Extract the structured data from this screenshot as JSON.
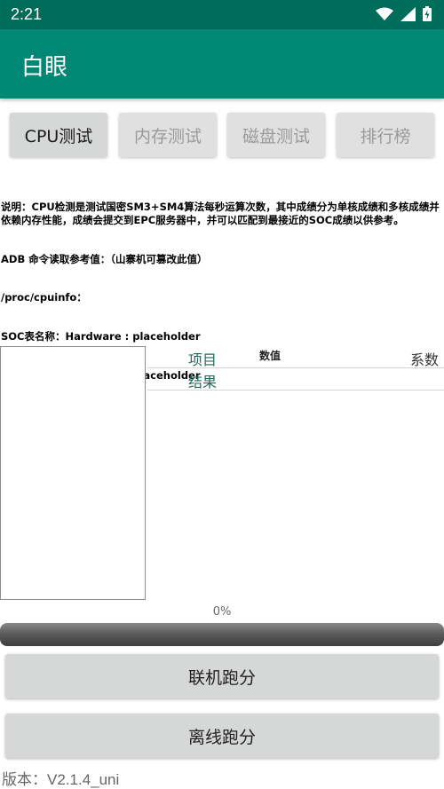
{
  "status_bar": {
    "time": "2:21"
  },
  "app_bar": {
    "title": "白眼"
  },
  "tabs": [
    {
      "label": "CPU测试",
      "active": true
    },
    {
      "label": "内存测试",
      "active": false
    },
    {
      "label": "磁盘测试",
      "active": false
    },
    {
      "label": "排行榜",
      "active": false
    }
  ],
  "description": {
    "line1": "说明：CPU检测是测试国密SM3+SM4算法每秒运算次数，其中成绩分为单核成绩和多核成绩并依赖内存性能，成绩会提交到EPC服务器中，并可以匹配到最接近的SOC成绩以供参考。",
    "line2": "ADB 命令读取参考值：（山寨机可篡改此值）",
    "line3": "/proc/cpuinfo：",
    "line4": "SOC表名称：Hardware : placeholder",
    "line5": "SOC里名称：Hardware : placeholder"
  },
  "table": {
    "col_item": "项目",
    "col_value": "数值",
    "col_factor": "系数",
    "result_label": "结果"
  },
  "progress": {
    "text": "0%",
    "value": 0
  },
  "buttons": {
    "online": "联机跑分",
    "offline": "离线跑分"
  },
  "version": "版本：V2.1.4_uni"
}
